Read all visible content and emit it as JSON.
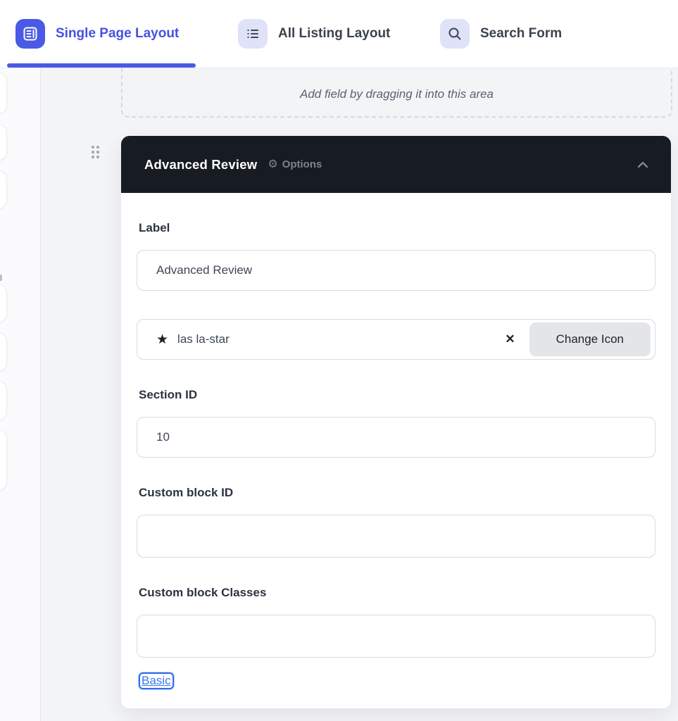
{
  "tabbar": {
    "tabs": [
      {
        "label": "Single Page Layout",
        "active": true
      },
      {
        "label": "All Listing Layout",
        "active": false
      },
      {
        "label": "Search Form",
        "active": false
      }
    ]
  },
  "dropzone": {
    "hint": "Add field by dragging it into this area"
  },
  "panel": {
    "title": "Advanced Review",
    "options_label": "Options",
    "fields": {
      "label": {
        "label": "Label",
        "value": "Advanced Review"
      },
      "icon": {
        "value": "las la-star",
        "change_button_label": "Change Icon"
      },
      "section_id": {
        "label": "Section ID",
        "value": "10"
      },
      "custom_block_id": {
        "label": "Custom block ID",
        "value": ""
      },
      "custom_block_classes": {
        "label": "Custom block Classes",
        "value": ""
      }
    },
    "basic_link_label": "Basic"
  },
  "icons": {
    "star": "★",
    "close": "✕",
    "gear": "⚙"
  },
  "colors": {
    "accent_blue": "#4a5ae4",
    "tab_icon_lavender": "#dfe2f8",
    "header_dark": "#171b22",
    "link_blue": "#3b78f0",
    "input_border": "#d8dbe1",
    "button_gray": "#e3e5e9"
  }
}
